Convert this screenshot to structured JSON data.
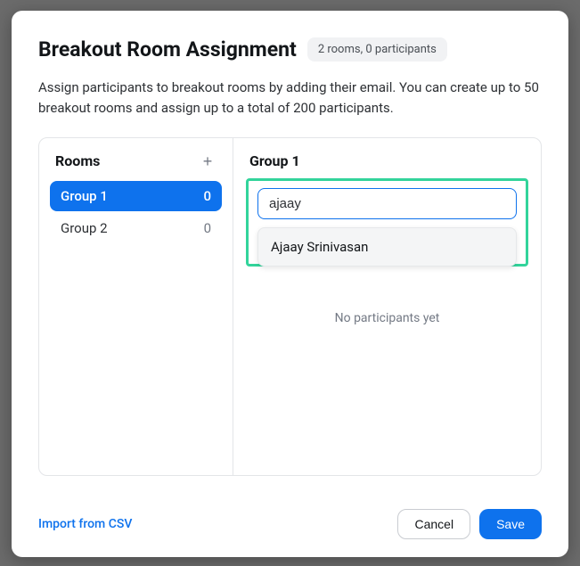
{
  "header": {
    "title": "Breakout Room Assignment",
    "badge": "2 rooms, 0 participants"
  },
  "description": "Assign participants to breakout rooms by adding their email. You can create up to 50 breakout rooms and assign up to a total of 200 participants.",
  "rooms": {
    "label": "Rooms",
    "add_symbol": "+",
    "items": [
      {
        "name": "Group 1",
        "count": "0",
        "selected": true
      },
      {
        "name": "Group 2",
        "count": "0",
        "selected": false
      }
    ]
  },
  "detail": {
    "group_title": "Group 1",
    "search_value": "ajaay",
    "suggestion": "Ajaay Srinivasan",
    "empty_text": "No participants yet"
  },
  "footer": {
    "import_label": "Import from CSV",
    "cancel_label": "Cancel",
    "save_label": "Save"
  }
}
